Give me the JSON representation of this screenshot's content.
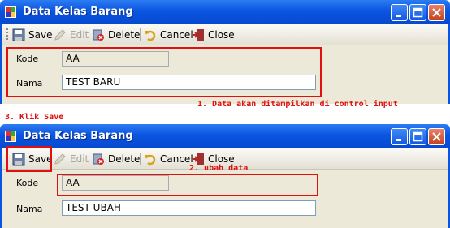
{
  "windows": [
    {
      "title": "Data Kelas Barang",
      "toolbar": {
        "save": "Save",
        "edit": "Edit",
        "delete": "Delete",
        "cancel": "Cancel",
        "close": "Close"
      },
      "fields": {
        "kode_label": "Kode",
        "kode_value": "AA",
        "nama_label": "Nama",
        "nama_value": "TEST BARU"
      }
    },
    {
      "title": "Data Kelas Barang",
      "toolbar": {
        "save": "Save",
        "edit": "Edit",
        "delete": "Delete",
        "cancel": "Cancel",
        "close": "Close"
      },
      "fields": {
        "kode_label": "Kode",
        "kode_value": "AA",
        "nama_label": "Nama",
        "nama_value": "TEST UBAH"
      }
    }
  ],
  "annotations": {
    "step1": "1. Data akan ditampilkan di control input",
    "step2": "2. ubah data",
    "step3": "3. Klik Save"
  },
  "colors": {
    "titlebar": "#0a55e0",
    "annotation": "#e01010",
    "window_body": "#ece9d8"
  }
}
